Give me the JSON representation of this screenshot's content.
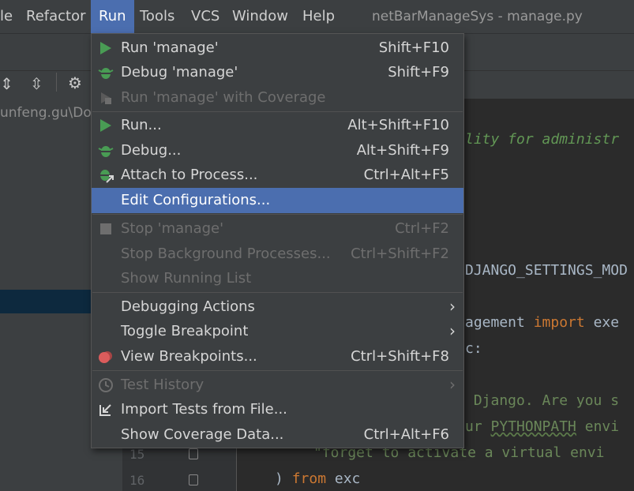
{
  "menubar": {
    "items": [
      "le",
      "Refactor",
      "Run",
      "Tools",
      "VCS",
      "Window",
      "Help"
    ],
    "active": "Run"
  },
  "window_title": "netBarManageSys - manage.py",
  "nav_path": "unfeng.gu\\Do",
  "run_menu": {
    "items": [
      {
        "label": "Run 'manage'",
        "shortcut": "Shift+F10",
        "icon": "run-icon",
        "enabled": true
      },
      {
        "label": "Debug 'manage'",
        "shortcut": "Shift+F9",
        "icon": "debug-icon",
        "enabled": true
      },
      {
        "label": "Run 'manage' with Coverage",
        "shortcut": "",
        "icon": "coverage-icon",
        "enabled": false
      },
      {
        "label": "Run...",
        "shortcut": "Alt+Shift+F10",
        "icon": "run-icon",
        "enabled": true
      },
      {
        "label": "Debug...",
        "shortcut": "Alt+Shift+F9",
        "icon": "debug-icon",
        "enabled": true
      },
      {
        "label": "Attach to Process...",
        "shortcut": "Ctrl+Alt+F5",
        "icon": "attach-icon",
        "enabled": true
      },
      {
        "label": "Edit Configurations...",
        "shortcut": "",
        "icon": "",
        "enabled": true,
        "selected": true
      },
      {
        "label": "Stop 'manage'",
        "shortcut": "Ctrl+F2",
        "icon": "stop-icon",
        "enabled": false
      },
      {
        "label": "Stop Background Processes...",
        "shortcut": "Ctrl+Shift+F2",
        "icon": "",
        "enabled": false
      },
      {
        "label": "Show Running List",
        "shortcut": "",
        "icon": "",
        "enabled": false
      },
      {
        "label": "Debugging Actions",
        "shortcut": "",
        "icon": "",
        "enabled": true,
        "submenu": true
      },
      {
        "label": "Toggle Breakpoint",
        "shortcut": "",
        "icon": "",
        "enabled": true,
        "submenu": true
      },
      {
        "label": "View Breakpoints...",
        "shortcut": "Ctrl+Shift+F8",
        "icon": "breakpoints-icon",
        "enabled": true
      },
      {
        "label": "Test History",
        "shortcut": "",
        "icon": "history-icon",
        "enabled": false,
        "submenu": true
      },
      {
        "label": "Import Tests from File...",
        "shortcut": "",
        "icon": "import-icon",
        "enabled": true
      },
      {
        "label": "Show Coverage Data...",
        "shortcut": "Ctrl+Alt+F6",
        "icon": "",
        "enabled": true
      }
    ]
  },
  "editor": {
    "code_fragments": {
      "c1": "lity for administr",
      "c2": "DJANGO_SETTINGS_MOD",
      "c3a": "agement ",
      "c3b": "import",
      "c3c": " exe",
      "c4": "c:",
      "c5": " Django. Are you s",
      "c6a": "ur ",
      "c6b": "PYTHONPATH",
      "c6c": " envi",
      "c7": "\"forget to activate a virtual envi",
      "c8a": ") ",
      "c8b": "from",
      "c8c": " exc"
    },
    "line_numbers": [
      "15",
      "16"
    ]
  },
  "colors": {
    "menu_bg": "#3c3f41",
    "selection": "#4b6eaf",
    "run_green": "#499c54",
    "breakpoint_red": "#db5c5c",
    "keyword_orange": "#cc7832",
    "comment_green": "#629755",
    "string_green": "#6a8759"
  }
}
